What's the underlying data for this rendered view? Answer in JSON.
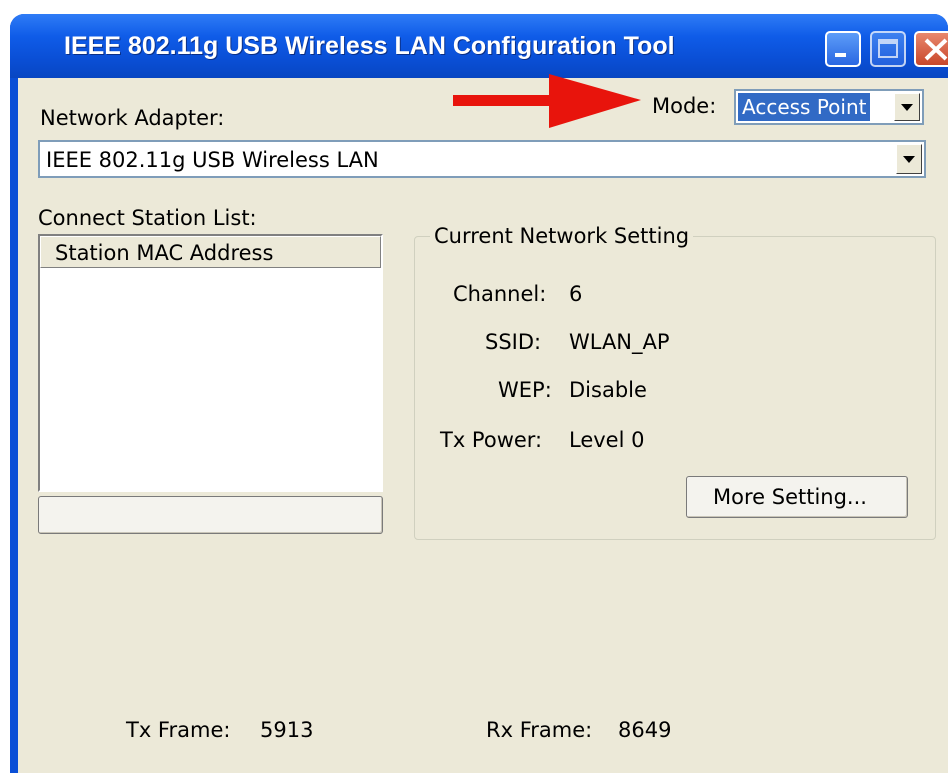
{
  "window": {
    "title": "IEEE 802.11g USB Wireless LAN Configuration Tool"
  },
  "titlebar_buttons": {
    "minimize": "minimize-icon",
    "maximize": "maximize-icon",
    "close": "close-icon"
  },
  "adapter": {
    "label": "Network Adapter:",
    "value": "IEEE 802.11g USB Wireless LAN"
  },
  "mode": {
    "label": "Mode:",
    "value": "Access Point"
  },
  "station_list": {
    "label": "Connect Station List:",
    "column_header": "Station MAC Address"
  },
  "network": {
    "group_title": "Current Network Setting",
    "channel_label": "Channel:",
    "channel_value": "6",
    "ssid_label": "SSID:",
    "ssid_value": "WLAN_AP",
    "wep_label": "WEP:",
    "wep_value": "Disable",
    "txpower_label": "Tx Power:",
    "txpower_value": "Level 0",
    "more_button": "More Setting..."
  },
  "stats": {
    "tx_label": "Tx Frame:",
    "tx_value": "5913",
    "rx_label": "Rx Frame:",
    "rx_value": "8649"
  },
  "colors": {
    "titlebar": "#0a4fd6",
    "client_bg": "#ece9d8",
    "selection": "#316ac5",
    "annotation_arrow": "#e8140c"
  }
}
